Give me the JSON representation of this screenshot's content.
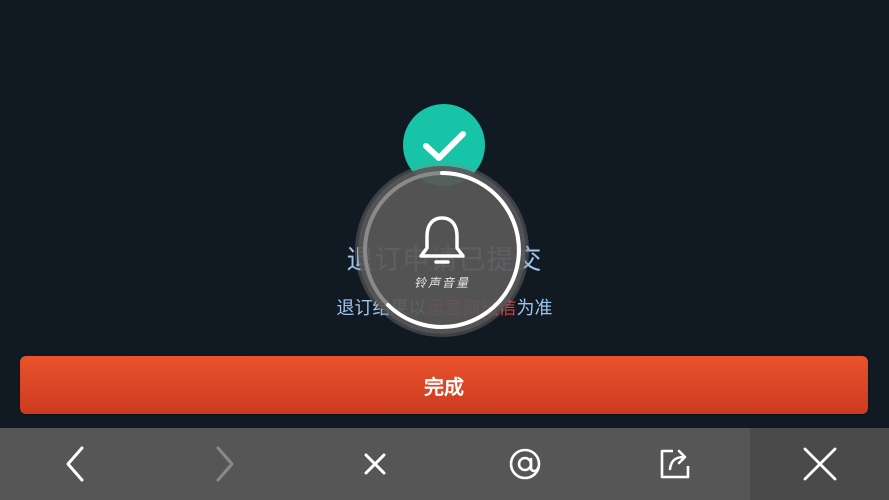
{
  "status": {
    "icon": "check-icon",
    "title": "退订申请已提交",
    "subtitle_part1": "退订结果以",
    "subtitle_highlight": "运营商短信",
    "subtitle_part2": "为准"
  },
  "overlay": {
    "icon": "bell-icon",
    "caption": "铃声音量"
  },
  "primary_button": {
    "label": "完成"
  },
  "toolbar": {
    "items": [
      "back-icon",
      "forward-icon",
      "stop-icon",
      "at-icon",
      "share-icon",
      "close-icon"
    ]
  },
  "colors": {
    "background": "#111a23",
    "accent": "#18c4a8",
    "button": "#e04a29",
    "text": "#9ec4ec",
    "highlight": "#e63a2e",
    "toolbar": "#565656"
  }
}
